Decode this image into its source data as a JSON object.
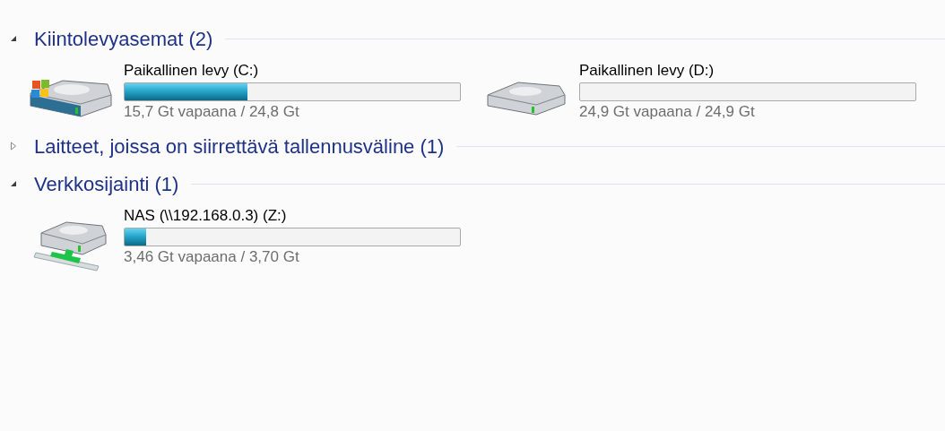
{
  "groups": [
    {
      "title": "Kiintolevyasemat (2)",
      "expanded": true,
      "drives": [
        {
          "kind": "windows",
          "name": "Paikallinen levy (C:)",
          "level": 0.367,
          "reading": "15,7 Gt vapaana / 24,8 Gt"
        },
        {
          "kind": "plain",
          "name": "Paikallinen levy (D:)",
          "level": 0,
          "reading": "24,9 Gt vapaana / 24,9 Gt"
        }
      ]
    },
    {
      "title": "Laitteet, joissa on siirrettävä tallennusväline (1)",
      "expanded": false
    },
    {
      "title": "Verkkosijainti (1)",
      "expanded": true,
      "drives": [
        {
          "kind": "network",
          "name": "NAS (\\\\192.168.0.3) (Z:)",
          "level": 0.065,
          "reading": "3,46 Gt vapaana / 3,70 Gt"
        }
      ]
    }
  ]
}
